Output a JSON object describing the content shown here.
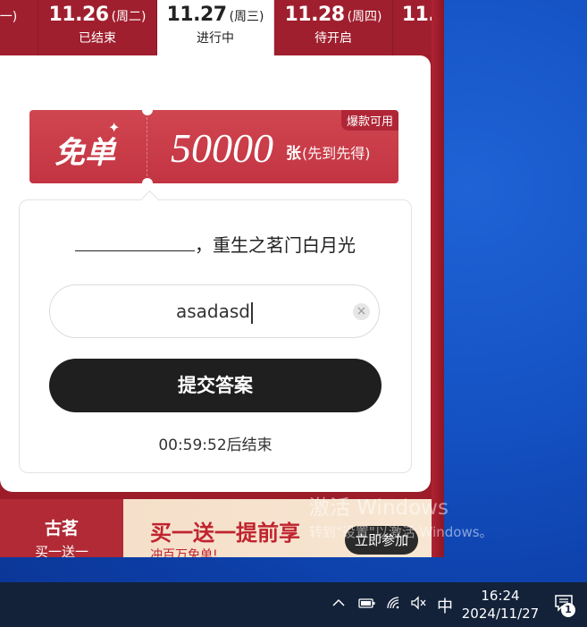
{
  "date_tabs": [
    {
      "num": "",
      "day": "周一)",
      "status": ""
    },
    {
      "num": "11.26",
      "day": "(周二)",
      "status": "已结束"
    },
    {
      "num": "11.27",
      "day": "(周三)",
      "status": "进行中"
    },
    {
      "num": "11.28",
      "day": "(周四)",
      "status": "待开启"
    },
    {
      "num": "11.",
      "day": "",
      "status": ""
    }
  ],
  "coupon": {
    "free_label": "免单",
    "count": "50000",
    "unit": "张",
    "note": "(先到先得)",
    "badge": "爆款可用"
  },
  "question": {
    "text": "，重生之茗门白月光"
  },
  "answer": {
    "value": "asadasd",
    "clear_symbol": "×"
  },
  "submit_label": "提交答案",
  "countdown": "00:59:52后结束",
  "banner": {
    "brand": "古茗",
    "sub": "买一送一",
    "headline": "买一送一提前享",
    "subline": "冲百万免单!",
    "join_label": "立即参加"
  },
  "watermark": {
    "line1": "激活 Windows",
    "line2": "转到\"设置\"以激活 Windows。"
  },
  "taskbar": {
    "ime": "中",
    "time": "16:24",
    "date": "2024/11/27",
    "notification_count": "1"
  },
  "colors": {
    "brand_red": "#9c1c2a",
    "coupon_red": "#c33442",
    "desktop_blue": "#1553c5",
    "taskbar": "#132239"
  }
}
